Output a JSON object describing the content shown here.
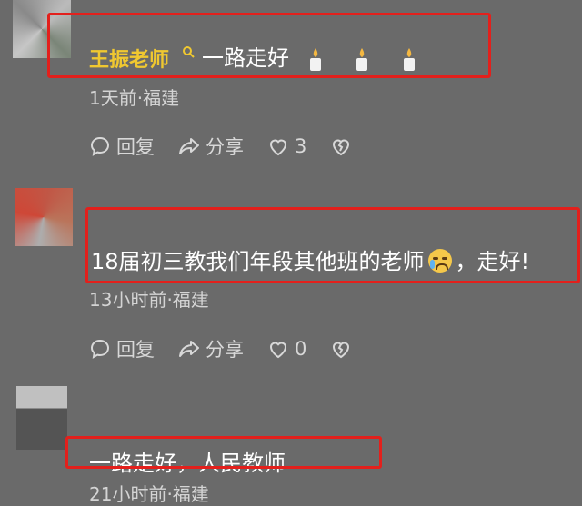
{
  "comments": [
    {
      "username": "王振老师",
      "text": "一路走好",
      "meta": "1天前·福建",
      "reply_label": "回复",
      "share_label": "分享",
      "like_count": "3",
      "icons": [
        "search-icon",
        "candle-icon",
        "candle-icon",
        "candle-icon"
      ]
    },
    {
      "username": "",
      "text_before": "18届初三教我们年段其他班的老师",
      "text_after": "，走好!",
      "meta": "13小时前·福建",
      "reply_label": "回复",
      "share_label": "分享",
      "like_count": "0",
      "icons": [
        "crying-face-icon"
      ]
    },
    {
      "username": "",
      "text": "一路走好，人民教师",
      "meta": "21小时前·福建"
    }
  ],
  "colors": {
    "background": "#6a6a6a",
    "username_highlight": "#f0c830",
    "highlight_box": "#e3201c"
  }
}
